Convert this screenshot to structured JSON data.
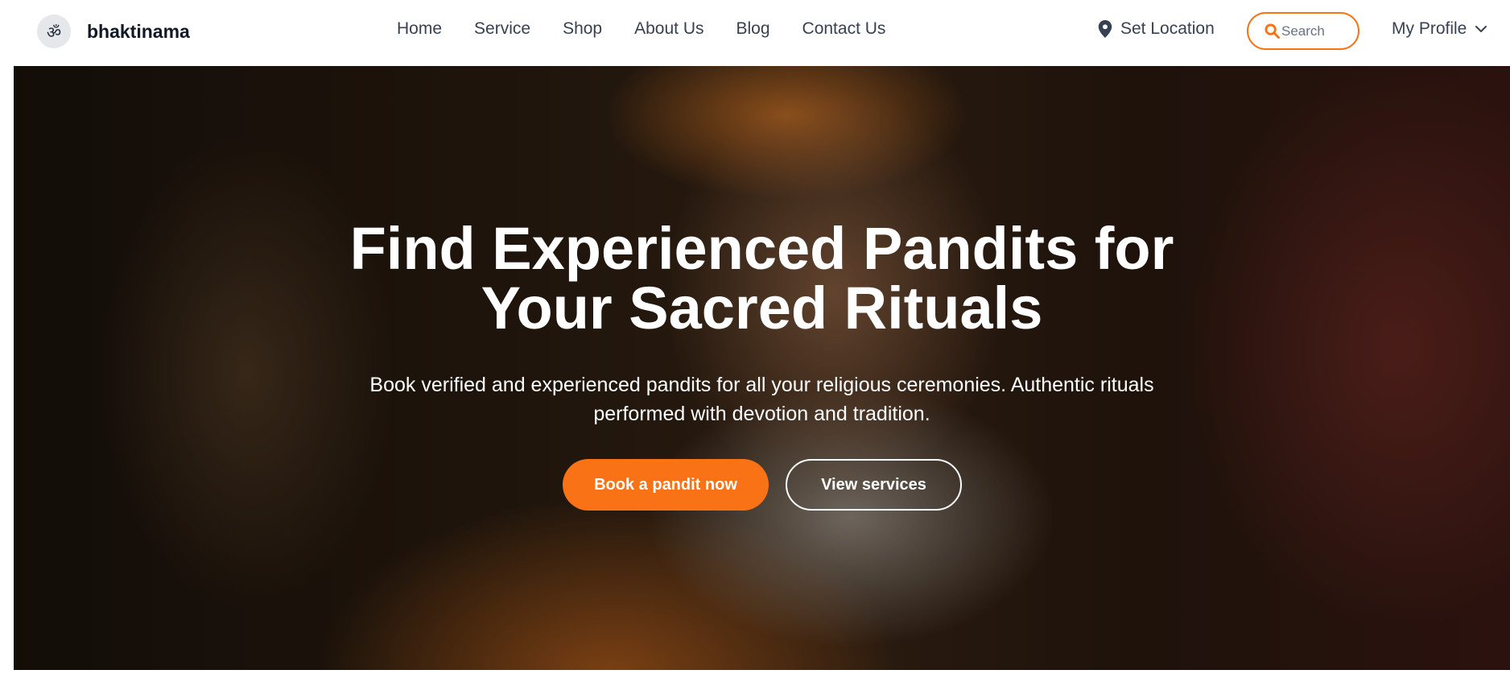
{
  "brand": {
    "logo_symbol": "ॐ",
    "name": "bhaktinama"
  },
  "nav": {
    "items": [
      {
        "label": "Home"
      },
      {
        "label": "Service"
      },
      {
        "label": "Shop"
      },
      {
        "label": "About Us"
      },
      {
        "label": "Blog"
      },
      {
        "label": "Contact Us"
      }
    ]
  },
  "header_actions": {
    "location_label": "Set Location",
    "location_icon": "map-pin-icon",
    "search_placeholder": "Search",
    "search_icon": "search-icon",
    "profile_label": "My Profile",
    "profile_icon": "chevron-down-icon"
  },
  "hero": {
    "title_line1": "Find Experienced Pandits for",
    "title_line2": "Your Sacred Rituals",
    "subtitle_line1": "Book verified and experienced pandits for all your religious ceremonies. Authentic rituals",
    "subtitle_line2": "performed with devotion and tradition.",
    "primary_cta": "Book a pandit now",
    "secondary_cta": "View services"
  },
  "colors": {
    "accent": "#f97316",
    "text_dark": "#111827",
    "nav_text": "#374151"
  }
}
